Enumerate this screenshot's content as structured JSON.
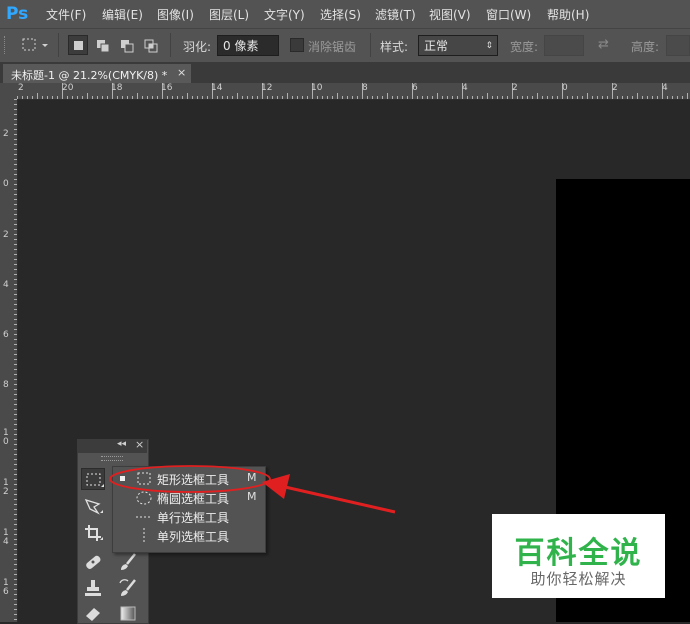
{
  "app": {
    "logo": "Ps"
  },
  "menu": [
    {
      "label": "文件(F)"
    },
    {
      "label": "编辑(E)"
    },
    {
      "label": "图像(I)"
    },
    {
      "label": "图层(L)"
    },
    {
      "label": "文字(Y)"
    },
    {
      "label": "选择(S)"
    },
    {
      "label": "滤镜(T)"
    },
    {
      "label": "视图(V)"
    },
    {
      "label": "窗口(W)"
    },
    {
      "label": "帮助(H)"
    }
  ],
  "options": {
    "feather_label": "羽化:",
    "feather_value": "0 像素",
    "antialias_label": "消除锯齿",
    "style_label": "样式:",
    "style_value": "正常",
    "width_label": "宽度:",
    "height_label": "高度:"
  },
  "document_tab": {
    "title": "未标题-1 @ 21.2%(CMYK/8) *",
    "close": "×"
  },
  "rulers": {
    "horizontal": [
      "2",
      "20",
      "18",
      "16",
      "14",
      "12",
      "10",
      "8",
      "6",
      "4",
      "2",
      "0",
      "2",
      "4"
    ],
    "vertical": [
      "2",
      "0",
      "2",
      "4",
      "6",
      "8",
      "1 0",
      "1 2",
      "1 4",
      "1 6"
    ]
  },
  "tools_panel": {
    "collapse": "◂◂",
    "close": "×"
  },
  "flyout": [
    {
      "label": "矩形选框工具",
      "shortcut": "M",
      "icon": "rect-marquee-icon",
      "selected": true
    },
    {
      "label": "椭圆选框工具",
      "shortcut": "M",
      "icon": "ellipse-marquee-icon",
      "selected": false
    },
    {
      "label": "单行选框工具",
      "shortcut": "",
      "icon": "single-row-marquee-icon",
      "selected": false
    },
    {
      "label": "单列选框工具",
      "shortcut": "",
      "icon": "single-column-marquee-icon",
      "selected": false
    }
  ],
  "watermark": {
    "title": "百科全说",
    "subtitle": "助你轻松解决"
  },
  "colors": {
    "ps_blue": "#31a8ff",
    "annotation_red": "#e02020",
    "watermark_green": "#2fb34a"
  }
}
